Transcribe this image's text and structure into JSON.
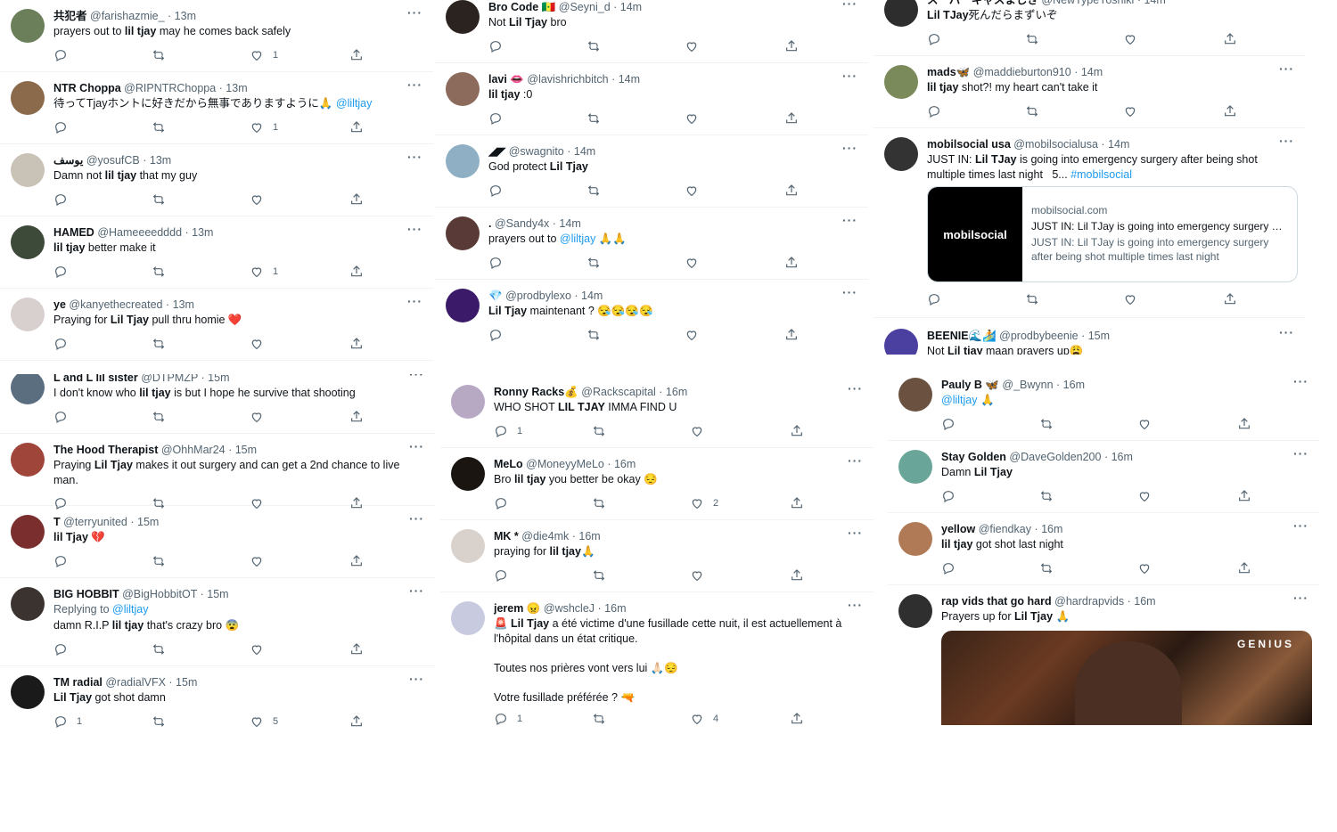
{
  "columns": [
    {
      "id": "c1a",
      "tweets": [
        {
          "name": "共犯者",
          "handle": "@farishazmie_",
          "time": "· 13m",
          "body": [
            {
              "t": "prayers out to "
            },
            {
              "t": "lil tjay",
              "b": 1
            },
            {
              "t": " may he comes back safely"
            }
          ],
          "replies": "",
          "likes": "1",
          "av": "#6a7f5a"
        },
        {
          "name": "NTR Choppa",
          "handle": "@RIPNTRChoppa",
          "time": "· 13m",
          "body": [
            {
              "t": "待ってTjayホントに好きだから無事でありますように🙏 "
            },
            {
              "t": "@liltjay",
              "l": 1
            }
          ],
          "replies": "",
          "likes": "1",
          "av": "#8a6a4a"
        },
        {
          "name": "يوسف",
          "handle": "@yosufCB",
          "time": "· 13m",
          "body": [
            {
              "t": "Damn not "
            },
            {
              "t": "lil tjay",
              "b": 1
            },
            {
              "t": " that my guy"
            }
          ],
          "replies": "",
          "likes": "",
          "av": "#c9c2b6"
        },
        {
          "name": "HAMED",
          "handle": "@Hameeeedddd",
          "time": "· 13m",
          "body": [
            {
              "t": "lil tjay",
              "b": 1
            },
            {
              "t": " better make it"
            }
          ],
          "replies": "",
          "likes": "1",
          "av": "#3d4a3a"
        },
        {
          "name": "ye",
          "handle": "@kanyethecreated",
          "time": "· 13m",
          "body": [
            {
              "t": "Praying for "
            },
            {
              "t": "Lil Tjay",
              "b": 1
            },
            {
              "t": " pull thru homie ❤️"
            }
          ],
          "replies": "",
          "likes": "",
          "av": "#d7d0cf"
        }
      ]
    },
    {
      "id": "c1b",
      "tweets": [
        {
          "name": "L and L lil sister",
          "handle": "@DTPMZP",
          "time": "· 15m",
          "body": [
            {
              "t": "I don't know who "
            },
            {
              "t": "lil tjay",
              "b": 1
            },
            {
              "t": " is but I hope he survive that shooting"
            }
          ],
          "replies": "",
          "likes": "",
          "av": "#5b6e80"
        },
        {
          "name": "The Hood Therapist",
          "handle": "@OhhMar24",
          "time": "· 15m",
          "body": [
            {
              "t": "Praying "
            },
            {
              "t": "Lil Tjay",
              "b": 1
            },
            {
              "t": " makes it out surgery and can get a 2nd chance to live man."
            }
          ],
          "replies": "",
          "likes": "",
          "av": "#a0453a"
        },
        {
          "name": "T",
          "handle": "@terryunited",
          "time": "· 15m",
          "body": [
            {
              "t": "lil Tjay",
              "b": 1
            },
            {
              "t": " 💔"
            }
          ],
          "replies": "",
          "likes": "",
          "av": "#7a2e2e"
        },
        {
          "name": "BIG HOBBIT",
          "handle": "@BigHobbitOT",
          "time": "· 15m",
          "reply_label": "Replying to ",
          "reply_to": "@liltjay",
          "body": [
            {
              "t": "damn R.I.P "
            },
            {
              "t": "lil tjay",
              "b": 1
            },
            {
              "t": " that's crazy bro 😨"
            }
          ],
          "replies": "",
          "likes": "",
          "av": "#3a3330"
        },
        {
          "name": "TM radial",
          "handle": "@radialVFX",
          "time": "· 15m",
          "body": [
            {
              "t": "Lil Tjay",
              "b": 1
            },
            {
              "t": " got shot damn"
            }
          ],
          "replies": "1",
          "likes": "5",
          "av": "#1a1a1a"
        }
      ]
    },
    {
      "id": "c2a",
      "tweets": [
        {
          "name": "Bro Code 🇸🇳",
          "handle": "@Seyni_d",
          "time": "· 14m",
          "body": [
            {
              "t": "Not "
            },
            {
              "t": "Lil Tjay",
              "b": 1
            },
            {
              "t": " bro"
            }
          ],
          "replies": "",
          "likes": "",
          "av": "#2b2320"
        },
        {
          "name": "lavi 👄",
          "handle": "@lavishrichbitch",
          "time": "· 14m",
          "body": [
            {
              "t": "lil tjay",
              "b": 1
            },
            {
              "t": " :0"
            }
          ],
          "replies": "",
          "likes": "",
          "av": "#8c6b5c"
        },
        {
          "name": "◢◤",
          "handle": "@swagnito",
          "time": "· 14m",
          "body": [
            {
              "t": "God protect "
            },
            {
              "t": "Lil Tjay",
              "b": 1
            }
          ],
          "replies": "",
          "likes": "",
          "av": "#8fb0c4"
        },
        {
          "name": ".",
          "handle": "@Sandy4x",
          "time": "· 14m",
          "body": [
            {
              "t": "prayers out to "
            },
            {
              "t": "@liltjay",
              "l": 1
            },
            {
              "t": " 🙏🙏"
            }
          ],
          "replies": "",
          "likes": "",
          "av": "#5a3a36"
        },
        {
          "name": "💎",
          "handle": "@prodbylexo",
          "time": "· 14m",
          "body": [
            {
              "t": "Lil Tjay",
              "b": 1
            },
            {
              "t": " maintenant ? 😪😪😪😪"
            }
          ],
          "replies": "",
          "likes": "",
          "av": "#3b1a6a"
        }
      ]
    },
    {
      "id": "c2b",
      "tweets": [
        {
          "name": "Ronny Racks💰",
          "handle": "@Rackscapital",
          "time": "· 16m",
          "body": [
            {
              "t": "WHO SHOT "
            },
            {
              "t": "LIL TJAY",
              "b": 1
            },
            {
              "t": " IMMA FIND U"
            }
          ],
          "replies": "1",
          "likes": "",
          "av": "#b7a9c4"
        },
        {
          "name": "MeLo",
          "handle": "@MoneyyMeLo",
          "time": "· 16m",
          "body": [
            {
              "t": "Bro "
            },
            {
              "t": "lil tjay",
              "b": 1
            },
            {
              "t": " you better be okay 😔"
            }
          ],
          "replies": "",
          "likes": "2",
          "av": "#1a1510"
        },
        {
          "name": "MK  *",
          "handle": "@die4mk",
          "time": "· 16m",
          "body": [
            {
              "t": "praying for "
            },
            {
              "t": "lil tjay",
              "b": 1
            },
            {
              "t": "🙏"
            }
          ],
          "replies": "",
          "likes": "",
          "av": "#d9d2cc"
        },
        {
          "name": "jerem 😠",
          "handle": "@wshcleJ",
          "time": "· 16m",
          "body": [
            {
              "t": "🚨 "
            },
            {
              "t": "Lil Tjay",
              "b": 1
            },
            {
              "t": " a été victime d'une fusillade cette nuit, il est actuellement à l'hôpital dans un état critique.\n\nToutes nos prières vont vers lui 🙏🏻😔\n\nVotre fusillade préférée ? 🔫"
            }
          ],
          "replies": "1",
          "likes": "4",
          "av": "#c8cbe0"
        }
      ]
    },
    {
      "id": "c3a",
      "tweets": [
        {
          "name": "スーパーギャスましき",
          "handle": "@NewTypeYoshiki",
          "time": "· 14m",
          "body": [
            {
              "t": "Lil TJay",
              "b": 1
            },
            {
              "t": "死んだらまずいぞ"
            }
          ],
          "replies": "",
          "likes": "",
          "av": "#2d2d2d"
        },
        {
          "name": "mads🦋",
          "handle": "@maddieburton910",
          "time": "· 14m",
          "body": [
            {
              "t": "lil tjay",
              "b": 1
            },
            {
              "t": " shot?! my heart can't take it"
            }
          ],
          "replies": "",
          "likes": "",
          "av": "#7b8a5b"
        },
        {
          "name": "mobilsocial usa",
          "handle": "@mobilsocialusa",
          "time": "· 14m",
          "body": [
            {
              "t": "JUST IN: "
            },
            {
              "t": "Lil TJay",
              "b": 1
            },
            {
              "t": " is going into emergency surgery after being shot multiple times last night   5... "
            },
            {
              "t": "#mobilsocial",
              "l": 1
            }
          ],
          "card": {
            "thumb": "mobilsocial",
            "domain": "mobilsocial.com",
            "title": "JUST IN: Lil TJay is going into emergency surgery af...",
            "desc1": "JUST IN: Lil TJay is going into emergency surgery",
            "desc2": "after being shot multiple times last night"
          },
          "replies": "",
          "likes": "",
          "av": "#333333"
        },
        {
          "name": "BEENIE🌊🏄",
          "handle": "@prodbybeenie",
          "time": "· 15m",
          "body": [
            {
              "t": "Not "
            },
            {
              "t": "Lil tjay",
              "b": 1
            },
            {
              "t": " maan prayers up😩"
            }
          ],
          "replies": "",
          "likes": "",
          "av": "#4b3fa0"
        }
      ]
    },
    {
      "id": "c3b",
      "tweets": [
        {
          "name": "Pauly B 🦋",
          "handle": "@_Bwynn",
          "time": "· 16m",
          "body": [
            {
              "t": "@liltjay",
              "l": 1
            },
            {
              "t": " 🙏"
            }
          ],
          "replies": "",
          "likes": "",
          "av": "#6b5240"
        },
        {
          "name": "Stay Golden",
          "handle": "@DaveGolden200",
          "time": "· 16m",
          "body": [
            {
              "t": "Damn "
            },
            {
              "t": "Lil Tjay",
              "b": 1
            }
          ],
          "replies": "",
          "likes": "",
          "av": "#6aa59a"
        },
        {
          "name": "yellow",
          "handle": "@fiendkay",
          "time": "· 16m",
          "body": [
            {
              "t": "lil tjay",
              "b": 1
            },
            {
              "t": " got shot last night"
            }
          ],
          "replies": "",
          "likes": "",
          "av": "#b07a56"
        },
        {
          "name": "rap vids that go hard",
          "handle": "@hardrapvids",
          "time": "· 16m",
          "body": [
            {
              "t": "Prayers up for "
            },
            {
              "t": "Lil Tjay",
              "b": 1
            },
            {
              "t": " 🙏"
            }
          ],
          "media": {
            "tag": "GENIUS"
          },
          "replies": "",
          "likes": "",
          "av": "#2f2f2f"
        }
      ]
    }
  ]
}
